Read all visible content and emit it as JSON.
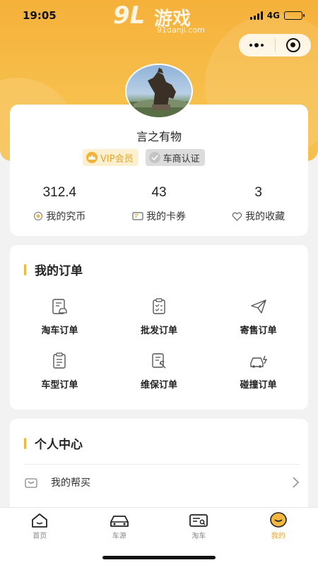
{
  "status_bar": {
    "time": "19:05",
    "network": "4G"
  },
  "watermark": {
    "logo": "9L",
    "name": "游戏",
    "url": "91danji.com"
  },
  "profile": {
    "username": "言之有物",
    "badges": {
      "vip": "VIP会员",
      "dealer": "车商认证"
    },
    "stats": [
      {
        "value": "312.4",
        "label": "我的究币"
      },
      {
        "value": "43",
        "label": "我的卡券"
      },
      {
        "value": "3",
        "label": "我的收藏"
      }
    ]
  },
  "orders": {
    "title": "我的订单",
    "items": [
      {
        "label": "淘车订单",
        "icon": "car-order-icon"
      },
      {
        "label": "批发订单",
        "icon": "wholesale-clipboard-icon"
      },
      {
        "label": "寄售订单",
        "icon": "send-plane-icon"
      },
      {
        "label": "车型订单",
        "icon": "model-clipboard-icon"
      },
      {
        "label": "维保订单",
        "icon": "maintenance-icon"
      },
      {
        "label": "碰撞订单",
        "icon": "collision-car-icon"
      }
    ]
  },
  "personal": {
    "title": "个人中心",
    "items": [
      {
        "label": "我的帮买",
        "icon": "basket-icon"
      }
    ]
  },
  "tabbar": {
    "tabs": [
      {
        "label": "首页",
        "icon": "home-icon",
        "active": false
      },
      {
        "label": "车源",
        "icon": "car-icon",
        "active": false
      },
      {
        "label": "淘车",
        "icon": "search-car-icon",
        "active": false
      },
      {
        "label": "我的",
        "icon": "profile-face-icon",
        "active": true
      }
    ]
  },
  "colors": {
    "accent": "#f3b63f",
    "active_tab": "#e8a62d",
    "header": "#f5b13a"
  }
}
